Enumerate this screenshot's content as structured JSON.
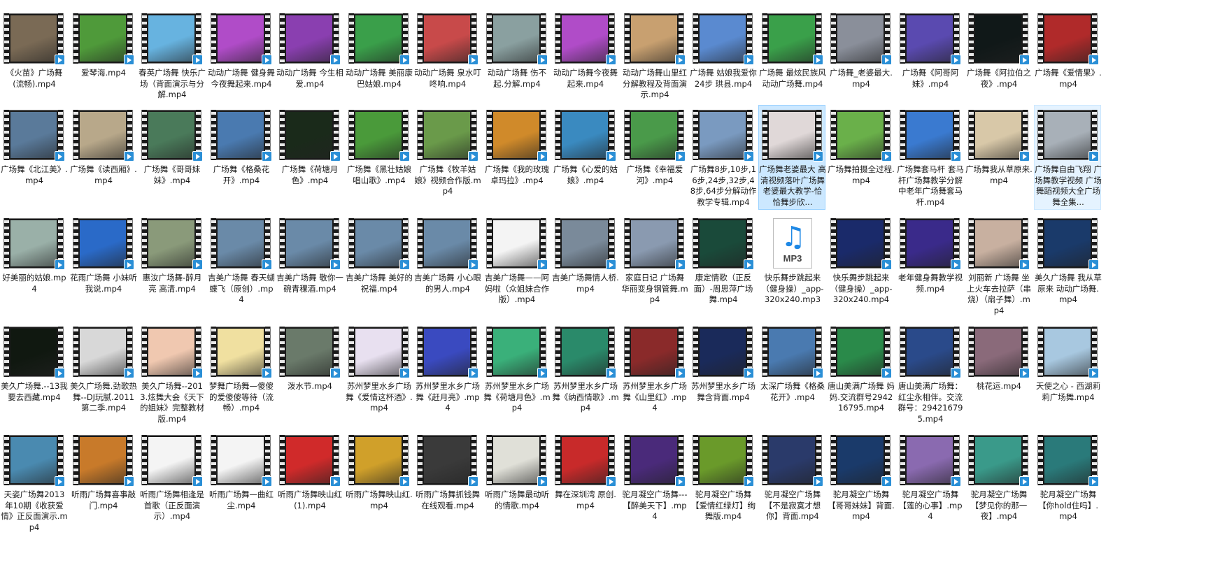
{
  "colors": {
    "selected_bg": "#cce8ff",
    "hover_bg": "#e5f3ff",
    "play_badge": "#2a8fd6"
  },
  "files": [
    {
      "name": "《火苗》广场舞(流畅).mp4",
      "type": "video",
      "thumb": "#7a6a55"
    },
    {
      "name": "爱琴海.mp4",
      "type": "video",
      "thumb": "#4f9a3a"
    },
    {
      "name": "春英广场舞 快乐广场（背面演示与分解.mp4",
      "type": "video",
      "thumb": "#67b3e0"
    },
    {
      "name": "动动广场舞 健身舞 今夜舞起来.mp4",
      "type": "video",
      "thumb": "#b04cc8"
    },
    {
      "name": "动动广场舞 今生相爱.mp4",
      "type": "video",
      "thumb": "#8a3fb0"
    },
    {
      "name": "动动广场舞 美丽康巴姑娘.mp4",
      "type": "video",
      "thumb": "#3a9f4a"
    },
    {
      "name": "动动广场舞 泉水叮咚响.mp4",
      "type": "video",
      "thumb": "#c84a4a"
    },
    {
      "name": "动动广场舞 伤不起.分解.mp4",
      "type": "video",
      "thumb": "#8aa0a0"
    },
    {
      "name": "动动广场舞今夜舞起来.mp4",
      "type": "video",
      "thumb": "#b04cc8"
    },
    {
      "name": "动动广场舞山里红分解教程及背面演示.mp4",
      "type": "video",
      "thumb": "#c8a070"
    },
    {
      "name": "广场舞 姑娘我爱你 24步 珙县.mp4",
      "type": "video",
      "thumb": "#5a8ad0"
    },
    {
      "name": "广场舞 最炫民族风 动动广场舞.mp4",
      "type": "video",
      "thumb": "#3aa04a"
    },
    {
      "name": "广场舞_老婆最大.mp4",
      "type": "video",
      "thumb": "#8a8f9a"
    },
    {
      "name": "广场舞《阿哥阿妹》.mp4",
      "type": "video",
      "thumb": "#5a4ab0"
    },
    {
      "name": "广场舞《阿拉伯之夜》.mp4",
      "type": "video",
      "thumb": "#101818"
    },
    {
      "name": "广场舞《爱情果》.mp4",
      "type": "video",
      "thumb": "#b02a2a"
    },
    {
      "name": "广场舞《北江美》.mp4",
      "type": "video",
      "thumb": "#5a7a9a"
    },
    {
      "name": "广场舞《读西厢》.mp4",
      "type": "video",
      "thumb": "#b8a88a"
    },
    {
      "name": "广场舞《哥哥妹妹》.mp4",
      "type": "video",
      "thumb": "#4a7a5a"
    },
    {
      "name": "广场舞《格桑花开》.mp4",
      "type": "video",
      "thumb": "#4a7ab0"
    },
    {
      "name": "广场舞《荷塘月色》.mp4",
      "type": "video",
      "thumb": "#1a2a1a"
    },
    {
      "name": "广场舞《黑壮姑娘唱山歌》.mp4",
      "type": "video",
      "thumb": "#4a9a3a"
    },
    {
      "name": "广场舞《牧羊姑娘》视频合作版.mp4",
      "type": "video",
      "thumb": "#6a9a4a"
    },
    {
      "name": "广场舞《我的玫瑰卓玛拉》.mp4",
      "type": "video",
      "thumb": "#d08a2a"
    },
    {
      "name": "广场舞《心爱的姑娘》.mp4",
      "type": "video",
      "thumb": "#3a8ac0"
    },
    {
      "name": "广场舞《幸福爱河》.mp4",
      "type": "video",
      "thumb": "#4a9a4a"
    },
    {
      "name": "广场舞8步,10步,16步,24步,32步,48步,64步分解动作教学专辑.mp4",
      "type": "video",
      "thumb": "#7a9ac0"
    },
    {
      "name": "广场舞老婆最大 高清视频落叶广场舞老婆最大教学-恰恰舞步欣...",
      "type": "video",
      "thumb": "#e0d8d8",
      "state": "selected"
    },
    {
      "name": "广场舞拍摄全过程.mp4",
      "type": "video",
      "thumb": "#6ab04a"
    },
    {
      "name": "广场舞套马杆 套马杆广场舞教学分解 中老年广场舞套马杆.mp4",
      "type": "video",
      "thumb": "#3a7ad0"
    },
    {
      "name": "广场舞我从草原来.mp4",
      "type": "video",
      "thumb": "#d8c8a8"
    },
    {
      "name": "广场舞自由飞翔 广场舞教学视频 广场舞蹈视频大全广场舞全集...",
      "type": "video",
      "thumb": "#a8b0b8",
      "state": "hover"
    },
    {
      "name": "好美丽的姑娘.mp4",
      "type": "video",
      "thumb": "#9ab0a8"
    },
    {
      "name": "花雨广场舞 小妹听我说.mp4",
      "type": "video",
      "thumb": "#2a6ac8"
    },
    {
      "name": "惠汝广场舞-醉月亮 高清.mp4",
      "type": "video",
      "thumb": "#8a9a7a"
    },
    {
      "name": "吉美广场舞 春天蝴蝶飞（原创）.mp4",
      "type": "video",
      "thumb": "#6a8aa8"
    },
    {
      "name": "吉美广场舞 敬你一碗青稞酒.mp4",
      "type": "video",
      "thumb": "#6a8aa8"
    },
    {
      "name": "吉美广场舞 美好的祝福.mp4",
      "type": "video",
      "thumb": "#6a8aa8"
    },
    {
      "name": "吉美广场舞 小心眼的男人.mp4",
      "type": "video",
      "thumb": "#6a8aa8"
    },
    {
      "name": "吉美广场舞——阿妈啦（众姐妹合作版）.mp4",
      "type": "video",
      "thumb": "#f4f4f4"
    },
    {
      "name": "吉美广场舞情人桥.mp4",
      "type": "video",
      "thumb": "#7a8a9a"
    },
    {
      "name": "家庭日记 广场舞 华丽变身钢管舞.mp4",
      "type": "video",
      "thumb": "#8a9ab0"
    },
    {
      "name": "康定情歌（正反面）-周思萍广场舞.mp4",
      "type": "video",
      "thumb": "#1a4a3a"
    },
    {
      "name": "快乐舞步跳起来（健身操）_app-320x240.mp3",
      "type": "mp3",
      "thumb": "#ffffff"
    },
    {
      "name": "快乐舞步跳起来（健身操）_app-320x240.mp4",
      "type": "video",
      "thumb": "#1a2a6a"
    },
    {
      "name": "老年健身舞教学视频.mp4",
      "type": "video",
      "thumb": "#3a2a8a"
    },
    {
      "name": "刘丽新 广场舞 坐上火车去拉萨（串烧）（扇子舞）.mp4",
      "type": "video",
      "thumb": "#c8b0a0"
    },
    {
      "name": "美久广场舞 我从草原来 动动广场舞.mp4",
      "type": "video",
      "thumb": "#1a3a6a"
    },
    {
      "name": "美久广场舞.--13我要去西藏.mp4",
      "type": "video",
      "thumb": "#101810"
    },
    {
      "name": "美久广场舞.劲歌热舞--DJ玩腻.2011第二季.mp4",
      "type": "video",
      "thumb": "#d8d8d8"
    },
    {
      "name": "美久广场舞--2013.炫舞大会《天下的姐妹》完整教材版.mp4",
      "type": "video",
      "thumb": "#f0c8b0"
    },
    {
      "name": "梦舞广场舞—傻傻的爱傻傻等待（流畅）.mp4",
      "type": "video",
      "thumb": "#f0e0a0"
    },
    {
      "name": "泼水节.mp4",
      "type": "video",
      "thumb": "#6a7a6a"
    },
    {
      "name": "苏州梦里水乡广场舞《爱情这杯酒》.mp4",
      "type": "video",
      "thumb": "#e8e0f0"
    },
    {
      "name": "苏州梦里水乡广场舞《赶月亮》.mp4",
      "type": "video",
      "thumb": "#3a4ac0"
    },
    {
      "name": "苏州梦里水乡广场舞《荷塘月色》.mp4",
      "type": "video",
      "thumb": "#3ab07a"
    },
    {
      "name": "苏州梦里水乡广场舞《纳西情歌》.mp4",
      "type": "video",
      "thumb": "#2a8a6a"
    },
    {
      "name": "苏州梦里水乡广场舞《山里红》.mp4",
      "type": "video",
      "thumb": "#8a2a2a"
    },
    {
      "name": "苏州梦里水乡广场舞含背面.mp4",
      "type": "video",
      "thumb": "#1a2a5a"
    },
    {
      "name": "太深广场舞《格桑花开》.mp4",
      "type": "video",
      "thumb": "#4a7ab0"
    },
    {
      "name": "唐山美满广场舞 妈妈.交流群号294216795.mp4",
      "type": "video",
      "thumb": "#2a8a4a"
    },
    {
      "name": "唐山美满广场舞：红尘永相伴。交流群号：294216795.mp4",
      "type": "video",
      "thumb": "#2a4a8a"
    },
    {
      "name": "桃花运.mp4",
      "type": "video",
      "thumb": "#8a6a7a"
    },
    {
      "name": "天使之心 - 西湖莉莉广场舞.mp4",
      "type": "video",
      "thumb": "#a8c8e0"
    },
    {
      "name": "天姿广场舞2013年10期《收获爱情》正反面演示.mp4",
      "type": "video",
      "thumb": "#4a8ab0"
    },
    {
      "name": "听雨广场舞喜事敲门.mp4",
      "type": "video",
      "thumb": "#c87a2a"
    },
    {
      "name": "听雨广场舞相逢是首歌（正反面演示）.mp4",
      "type": "video",
      "thumb": "#f4f4f4"
    },
    {
      "name": "听雨广场舞—曲红尘.mp4",
      "type": "video",
      "thumb": "#f4f4f4"
    },
    {
      "name": "听雨广场舞映山红(1).mp4",
      "type": "video",
      "thumb": "#d02a2a"
    },
    {
      "name": "听雨广场舞映山红.mp4",
      "type": "video",
      "thumb": "#d0a02a"
    },
    {
      "name": "听雨广场舞抓钱舞 在线观看.mp4",
      "type": "video",
      "thumb": "#3a3a3a"
    },
    {
      "name": "听雨广场舞最动听的情歌.mp4",
      "type": "video",
      "thumb": "#e0e0d8"
    },
    {
      "name": "舞在深圳湾 原创.mp4",
      "type": "video",
      "thumb": "#c82a2a"
    },
    {
      "name": "驼月凝空广场舞---【醉美天下】.mp4",
      "type": "video",
      "thumb": "#4a2a7a"
    },
    {
      "name": "驼月凝空广场舞【爱情红绿灯】绚舞版.mp4",
      "type": "video",
      "thumb": "#6a9a2a"
    },
    {
      "name": "驼月凝空广场舞【不是寂寞才想你】背面.mp4",
      "type": "video",
      "thumb": "#2a3a6a"
    },
    {
      "name": "驼月凝空广场舞【哥哥妹妹】背面.mp4",
      "type": "video",
      "thumb": "#1a3a6a"
    },
    {
      "name": "驼月凝空广场舞【莲的心事】.mp4",
      "type": "video",
      "thumb": "#8a6ab0"
    },
    {
      "name": "驼月凝空广场舞【梦见你的那一夜】.mp4",
      "type": "video",
      "thumb": "#3a9a8a"
    },
    {
      "name": "驼月凝空广场舞【你hold住吗】.mp4",
      "type": "video",
      "thumb": "#2a7a7a"
    }
  ]
}
